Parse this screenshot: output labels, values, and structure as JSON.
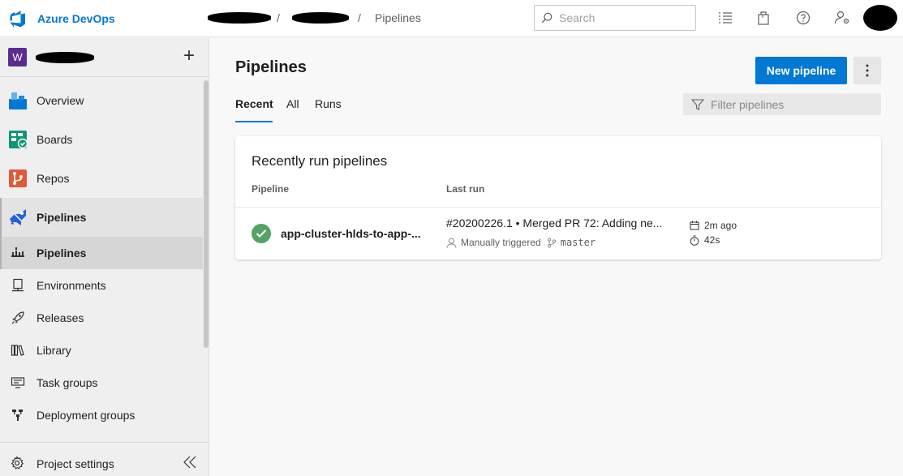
{
  "header": {
    "app_name": "Azure DevOps",
    "breadcrumb_sep": "/",
    "breadcrumb_current": "Pipelines",
    "search_placeholder": "Search"
  },
  "sidebar": {
    "project_initial": "W",
    "add_label": "+",
    "items": [
      {
        "label": "Overview",
        "icon": "overview-icon"
      },
      {
        "label": "Boards",
        "icon": "boards-icon"
      },
      {
        "label": "Repos",
        "icon": "repos-icon"
      },
      {
        "label": "Pipelines",
        "icon": "pipelines-icon"
      }
    ],
    "sub_items": [
      {
        "label": "Pipelines",
        "icon": "pipelines-sub-icon"
      },
      {
        "label": "Environments",
        "icon": "environments-icon"
      },
      {
        "label": "Releases",
        "icon": "releases-icon"
      },
      {
        "label": "Library",
        "icon": "library-icon"
      },
      {
        "label": "Task groups",
        "icon": "task-groups-icon"
      },
      {
        "label": "Deployment groups",
        "icon": "deployment-groups-icon"
      }
    ],
    "settings_label": "Project settings"
  },
  "main": {
    "title": "Pipelines",
    "new_button": "New pipeline",
    "tabs": [
      "Recent",
      "All",
      "Runs"
    ],
    "filter_placeholder": "Filter pipelines",
    "card": {
      "title": "Recently run pipelines",
      "col_pipeline": "Pipeline",
      "col_last_run": "Last run",
      "rows": [
        {
          "status": "succeeded",
          "name": "app-cluster-hlds-to-app-...",
          "run_title": "#20200226.1 • Merged PR 72: Adding ne...",
          "trigger": "Manually triggered",
          "branch": "master",
          "started": "2m ago",
          "duration": "42s"
        }
      ]
    }
  },
  "colors": {
    "accent": "#0078d4",
    "success": "#55a362",
    "project_badge": "#5c2d91"
  }
}
